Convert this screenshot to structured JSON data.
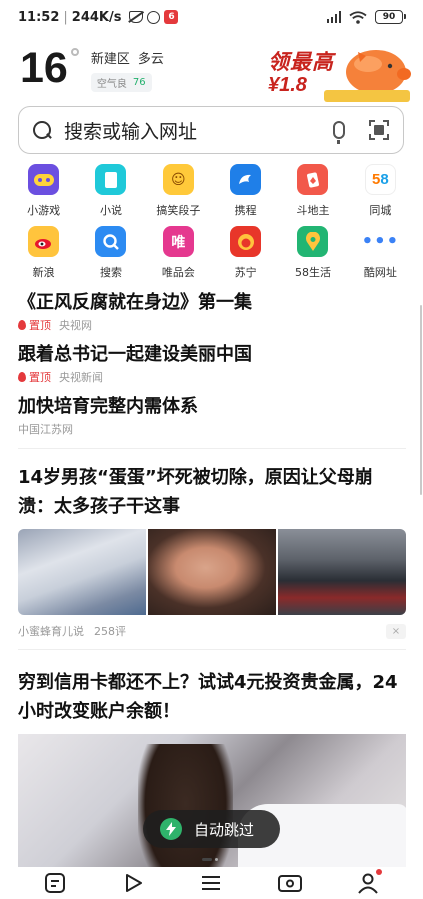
{
  "status": {
    "time": "11:52",
    "speed": "244K/s",
    "battery": "90",
    "app_badge": "6"
  },
  "weather": {
    "temp": "16",
    "district": "新建区",
    "condition": "多云",
    "aq_label": "空气良",
    "aq_value": "76"
  },
  "promo": {
    "line1": "领最高",
    "line2": "¥1.8"
  },
  "search": {
    "placeholder": "搜索或输入网址"
  },
  "apps": [
    {
      "label": "小游戏",
      "icon": "game-controller-icon",
      "color": "#6b4fe0"
    },
    {
      "label": "小说",
      "icon": "book-icon",
      "color": "#1fc9d9"
    },
    {
      "label": "搞笑段子",
      "icon": "laughing-face-icon",
      "color": "#ffc93a"
    },
    {
      "label": "携程",
      "icon": "dolphin-icon",
      "color": "#1f7fe8"
    },
    {
      "label": "斗地主",
      "icon": "poker-cards-icon",
      "color": "#f2584a"
    },
    {
      "label": "同城",
      "icon": "58-logo-icon",
      "color": "#ffffff"
    },
    {
      "label": "新浪",
      "icon": "weibo-eye-icon",
      "color": "#ffc43d"
    },
    {
      "label": "搜索",
      "icon": "search-app-icon",
      "color": "#2c8bf2"
    },
    {
      "label": "唯品会",
      "icon": "vip-icon",
      "color": "#e5388f"
    },
    {
      "label": "苏宁",
      "icon": "lion-icon",
      "color": "#e8362a"
    },
    {
      "label": "58生活",
      "icon": "map-pin-icon",
      "color": "#22b573"
    },
    {
      "label": "酷网址",
      "icon": "more-dots-icon",
      "color": "#ffffff"
    }
  ],
  "headlines": [
    {
      "title": "《正风反腐就在身边》第一集",
      "pin": "置顶",
      "source": "央视网"
    },
    {
      "title": "跟着总书记一起建设美丽中国",
      "pin": "置顶",
      "source": "央视新闻"
    },
    {
      "title": "加快培育完整内需体系",
      "pin": "",
      "source": "中国江苏网"
    }
  ],
  "article": {
    "title": "14岁男孩“蛋蛋”坏死被切除，原因让父母崩溃：太多孩子干这事",
    "source": "小蜜蜂育儿说",
    "comments": "258评",
    "close": "×"
  },
  "ad": {
    "title": "穷到信用卡都还不上？试试4元投资贵金属，24小时改变账户余额！"
  },
  "skip": {
    "label": "自动跳过"
  }
}
